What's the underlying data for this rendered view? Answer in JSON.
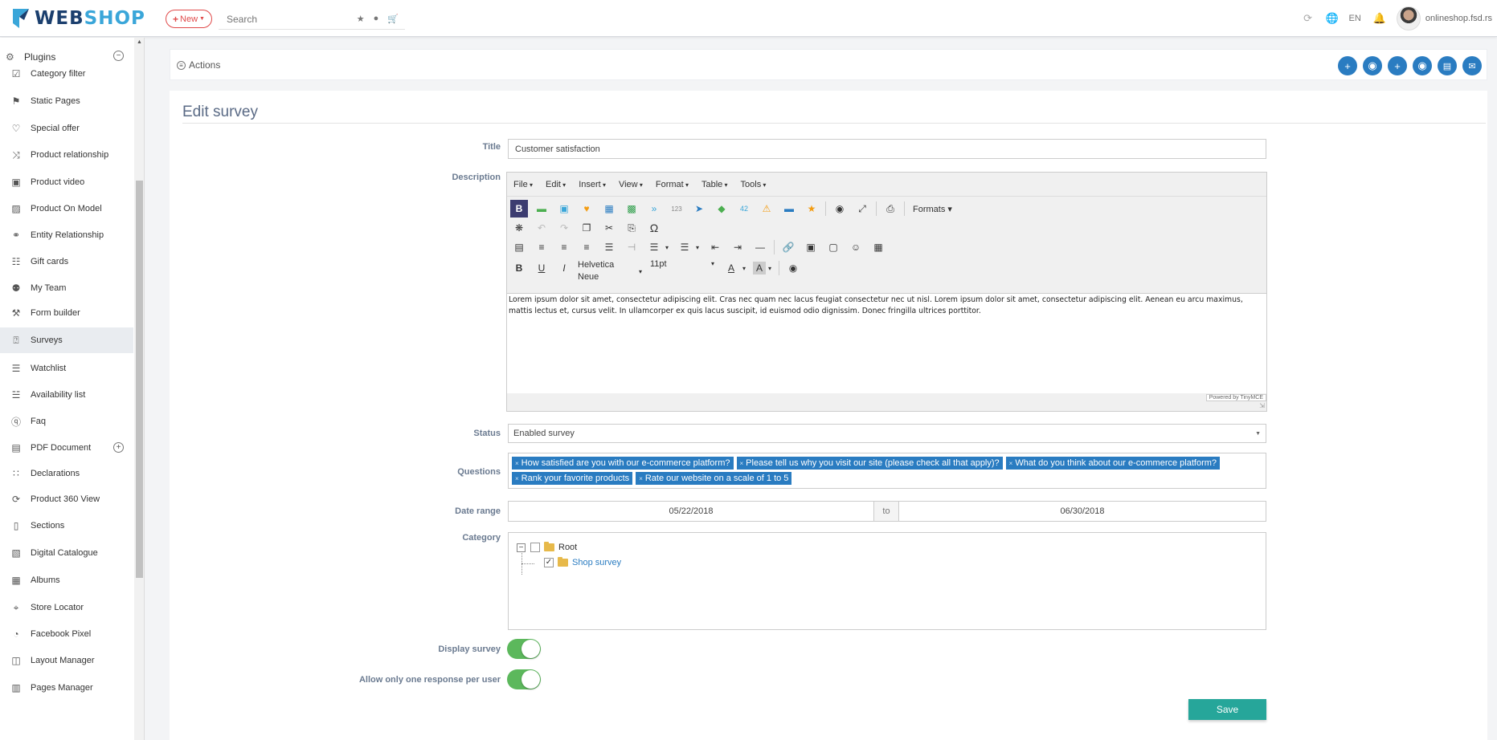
{
  "brand": {
    "name_part1": "WEB",
    "name_part2": "SHOP"
  },
  "topbar": {
    "new_label": "New",
    "search_placeholder": "Search",
    "language": "EN",
    "user": "onlineshop.fsd.rs"
  },
  "sidebar": {
    "header": "Plugins",
    "items": [
      {
        "label": "Category filter",
        "icon": "filter-check-icon"
      },
      {
        "label": "Static Pages",
        "icon": "bookmark-icon"
      },
      {
        "label": "Special offer",
        "icon": "heart-icon"
      },
      {
        "label": "Product relationship",
        "icon": "shuffle-icon"
      },
      {
        "label": "Product video",
        "icon": "video-icon"
      },
      {
        "label": "Product On Model",
        "icon": "image-icon"
      },
      {
        "label": "Entity Relationship",
        "icon": "link-icon"
      },
      {
        "label": "Gift cards",
        "icon": "gift-icon"
      },
      {
        "label": "My Team",
        "icon": "team-icon"
      },
      {
        "label": "Form builder",
        "icon": "tools-icon"
      },
      {
        "label": "Surveys",
        "icon": "question-icon"
      },
      {
        "label": "Watchlist",
        "icon": "watchlist-icon"
      },
      {
        "label": "Availability list",
        "icon": "availability-icon"
      },
      {
        "label": "Faq",
        "icon": "faq-icon"
      },
      {
        "label": "PDF Document",
        "icon": "pdf-icon"
      },
      {
        "label": "Declarations",
        "icon": "grid-icon"
      },
      {
        "label": "Product 360 View",
        "icon": "rotate-icon"
      },
      {
        "label": "Sections",
        "icon": "mobile-icon"
      },
      {
        "label": "Digital Catalogue",
        "icon": "catalogue-icon"
      },
      {
        "label": "Albums",
        "icon": "album-icon"
      },
      {
        "label": "Store Locator",
        "icon": "store-icon"
      },
      {
        "label": "Facebook Pixel",
        "icon": "pixel-icon"
      },
      {
        "label": "Layout Manager",
        "icon": "layout-icon"
      },
      {
        "label": "Pages Manager",
        "icon": "pages-icon"
      }
    ]
  },
  "actions": {
    "label": "Actions"
  },
  "page": {
    "title": "Edit survey"
  },
  "form": {
    "title_label": "Title",
    "title_value": "Customer satisfaction",
    "description_label": "Description",
    "editor": {
      "menus": [
        "File",
        "Edit",
        "Insert",
        "View",
        "Format",
        "Table",
        "Tools"
      ],
      "formats_label": "Formats",
      "font_family": "Helvetica Neue",
      "font_size": "11pt",
      "content": "Lorem ipsum dolor sit amet, consectetur adipiscing elit. Cras nec quam nec lacus feugiat consectetur nec ut nisl. Lorem ipsum dolor sit amet, consectetur adipiscing elit. Aenean eu arcu maximus, mattis lectus et, cursus velit. In ullamcorper ex quis lacus suscipit, id euismod odio dignissim. Donec fringilla ultrices porttitor.",
      "powered_by": "Powered by TinyMCE"
    },
    "status_label": "Status",
    "status_value": "Enabled survey",
    "questions_label": "Questions",
    "questions": [
      "How satisfied are you with our e-commerce platform?",
      "Please tell us why you visit our site (please check all that apply)?",
      "What do you think about our e-commerce platform?",
      "Rank your favorite products",
      "Rate our website on a scale of 1 to 5"
    ],
    "date_range_label": "Date range",
    "date_from": "05/22/2018",
    "date_to_label": "to",
    "date_to": "06/30/2018",
    "category_label": "Category",
    "category_root": "Root",
    "category_child": "Shop survey",
    "display_survey_label": "Display survey",
    "display_survey_on": true,
    "one_response_label": "Allow only one response per user",
    "one_response_on": true,
    "save_label": "Save"
  },
  "colors": {
    "accent": "#2a7cc1",
    "save": "#26a69a",
    "toggle": "#5cb85c",
    "new": "#e04a4a"
  }
}
